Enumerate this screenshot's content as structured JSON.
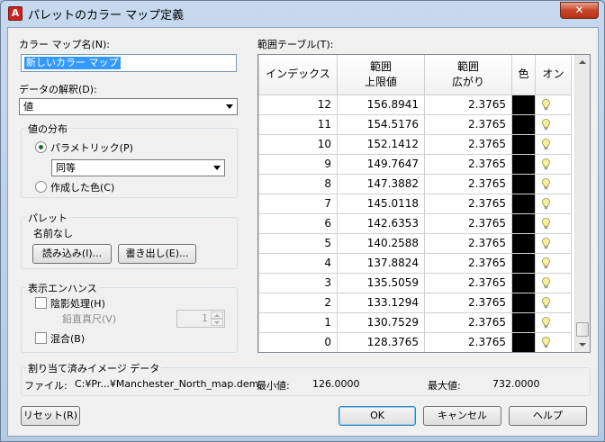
{
  "window": {
    "title": "パレットのカラー マップ定義",
    "close_glyph": "✕",
    "app_icon_letter": "A"
  },
  "left": {
    "colormap_name_label": "カラー マップ名(N):",
    "colormap_name_value": "新しいカラー マップ",
    "interpretation_label": "データの解釈(D):",
    "interpretation_value": "値",
    "distribution": {
      "title": "値の分布",
      "parametric_label": "パラメトリック(P)",
      "parametric_selected": true,
      "method_value": "同等",
      "created_color_label": "作成した色(C)"
    },
    "palette": {
      "title": "パレット",
      "name_text": "名前なし",
      "import_button": "読み込み(I)...",
      "export_button": "書き出し(E)..."
    },
    "display": {
      "title": "表示エンハンス",
      "shading_label": "陰影処理(H)",
      "exaggeration_label": "鉛直真尺(V)",
      "exaggeration_value": "1",
      "blend_label": "混合(B)"
    }
  },
  "range_table": {
    "label": "範囲テーブル(T):",
    "headers": {
      "index": "インデックス",
      "upper": [
        "範囲",
        "上限値"
      ],
      "spread": [
        "範囲",
        "広がり"
      ],
      "color": "色",
      "on": "オン"
    },
    "rows": [
      {
        "index": "12",
        "upper": "156.8941",
        "spread": "2.3765"
      },
      {
        "index": "11",
        "upper": "154.5176",
        "spread": "2.3765"
      },
      {
        "index": "10",
        "upper": "152.1412",
        "spread": "2.3765"
      },
      {
        "index": "9",
        "upper": "149.7647",
        "spread": "2.3765"
      },
      {
        "index": "8",
        "upper": "147.3882",
        "spread": "2.3765"
      },
      {
        "index": "7",
        "upper": "145.0118",
        "spread": "2.3765"
      },
      {
        "index": "6",
        "upper": "142.6353",
        "spread": "2.3765"
      },
      {
        "index": "5",
        "upper": "140.2588",
        "spread": "2.3765"
      },
      {
        "index": "4",
        "upper": "137.8824",
        "spread": "2.3765"
      },
      {
        "index": "3",
        "upper": "135.5059",
        "spread": "2.3765"
      },
      {
        "index": "2",
        "upper": "133.1294",
        "spread": "2.3765"
      },
      {
        "index": "1",
        "upper": "130.7529",
        "spread": "2.3765"
      },
      {
        "index": "0",
        "upper": "128.3765",
        "spread": "2.3765"
      }
    ],
    "row_color": "#000000",
    "on_icon": "lightbulb-icon"
  },
  "assigned_image": {
    "title": "割り当て済みイメージ データ",
    "file_label": "ファイル:",
    "file_value": "C:¥Pr...¥Manchester_North_map.dem",
    "min_label": "最小値:",
    "min_value": "126.0000",
    "max_label": "最大値:",
    "max_value": "732.0000"
  },
  "buttons": {
    "reset": "リセット(R)",
    "ok": "OK",
    "cancel": "キャンセル",
    "help": "ヘルプ"
  }
}
